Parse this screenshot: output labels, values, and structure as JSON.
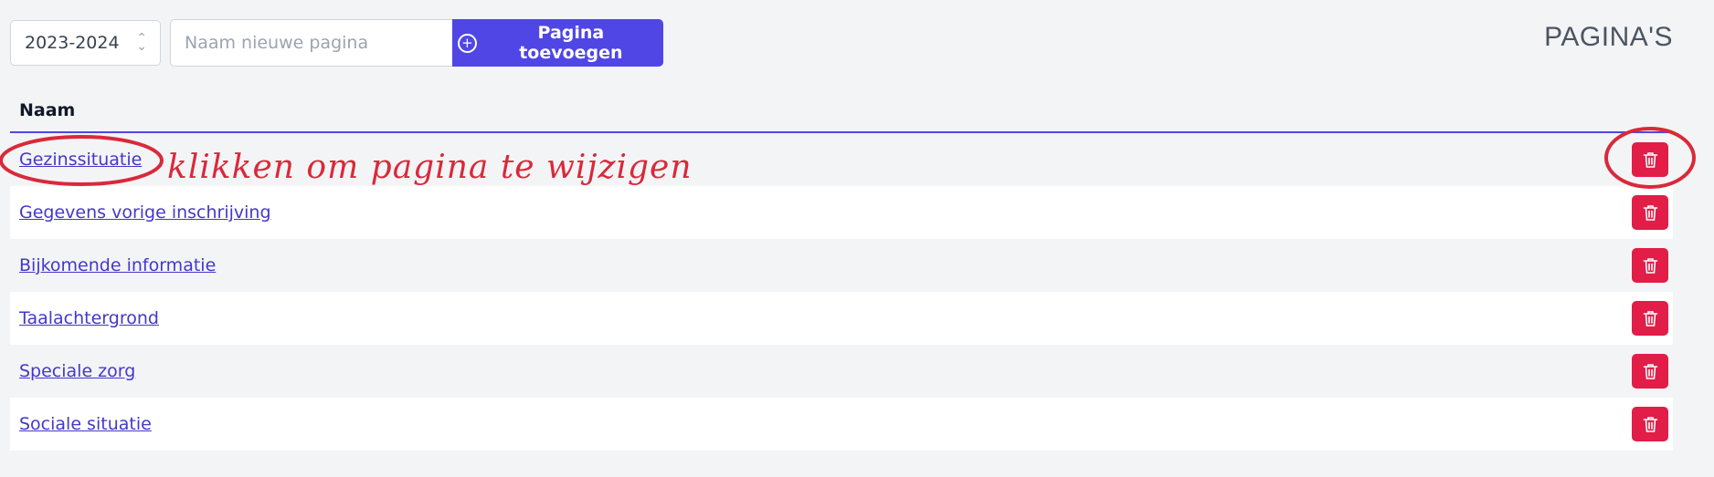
{
  "toolbar": {
    "year_select_value": "2023-2024",
    "new_page_placeholder": "Naam nieuwe pagina",
    "add_button_label": "Pagina toevoegen"
  },
  "page_heading": "PAGINA'S",
  "table": {
    "column_header": "Naam",
    "rows": [
      {
        "label": "Gezinssituatie"
      },
      {
        "label": "Gegevens vorige inschrijving"
      },
      {
        "label": "Bijkomende informatie"
      },
      {
        "label": "Taalachtergrond"
      },
      {
        "label": "Speciale zorg"
      },
      {
        "label": "Sociale situatie"
      }
    ]
  },
  "annotation": {
    "text": "klikken om pagina te wijzigen",
    "color": "#d9293a"
  },
  "colors": {
    "accent": "#4f46e5",
    "danger": "#e11d48",
    "link": "#4338ca"
  },
  "icons": {
    "add": "plus-circle-icon",
    "delete": "trash-icon",
    "select": "chevron-up-down-icon"
  }
}
